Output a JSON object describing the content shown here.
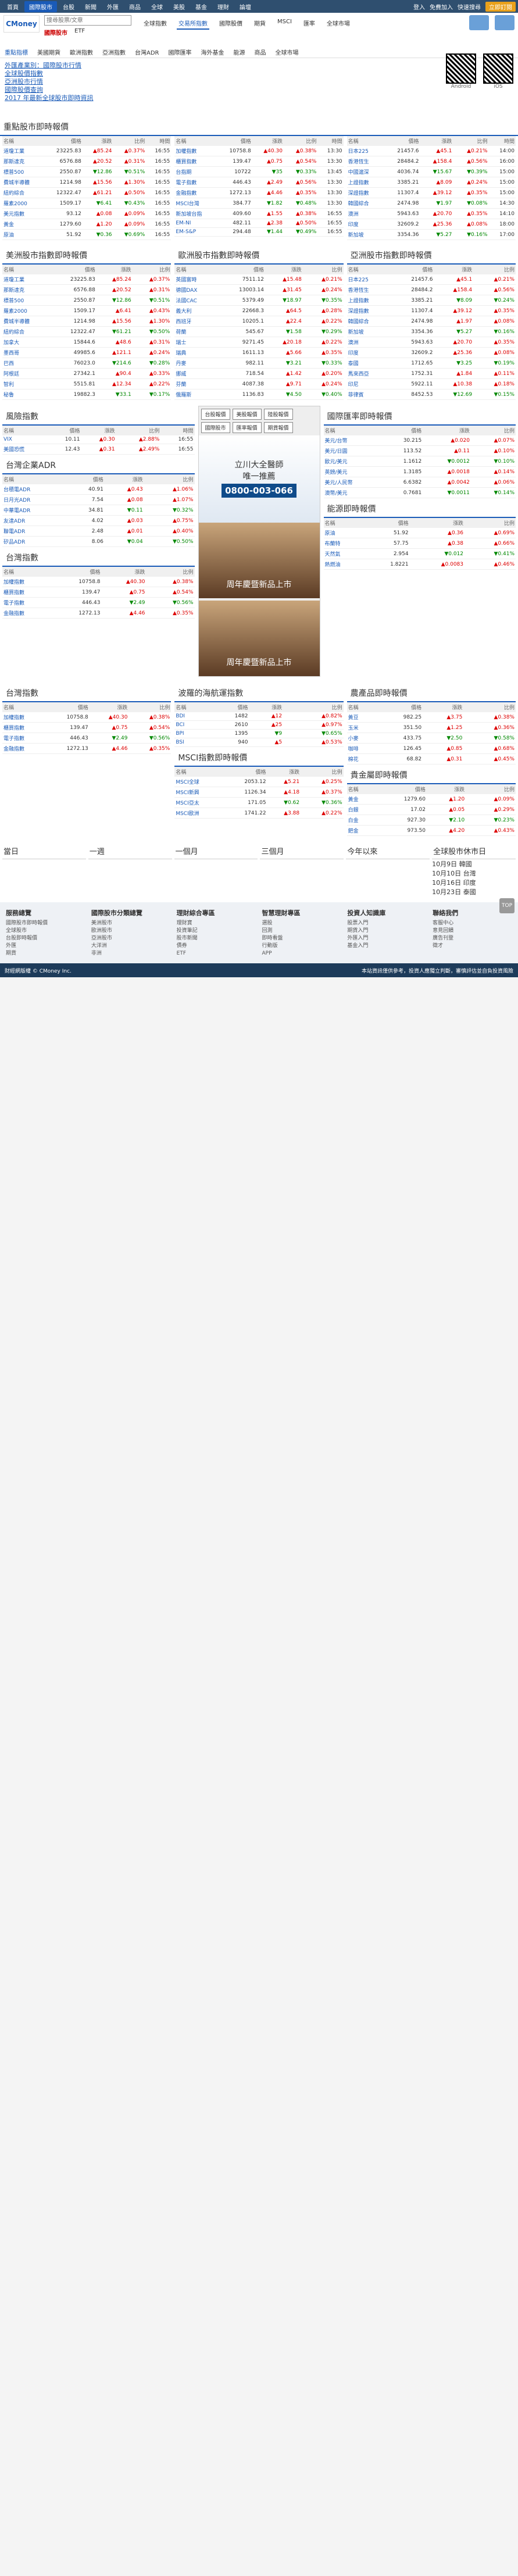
{
  "topbar": {
    "nav": [
      "首頁",
      "國際股市",
      "台股",
      "新聞",
      "外匯",
      "商品",
      "全球",
      "美股",
      "基金",
      "理財",
      "論壇"
    ],
    "active": 1,
    "right": [
      "登入",
      "免費加入",
      "快速搜尋"
    ],
    "btn": "立即訂閱"
  },
  "header": {
    "logo": "CMoney",
    "search_placeholder": "搜尋股票/文章",
    "search_tabs": [
      "國際股市",
      "ETF"
    ],
    "mid": [
      "全球指數",
      "交易所指數",
      "國際股價",
      "期貨",
      "MSCI",
      "匯率",
      "全球市場"
    ],
    "active": 1
  },
  "subnav": [
    "重點指標",
    "美國期貨",
    "歐洲指數",
    "亞洲指數",
    "台灣ADR",
    "國際匯率",
    "海外基金",
    "能源",
    "商品",
    "全球市場"
  ],
  "promo": {
    "links": [
      "外匯產業別：國際股市行情",
      "全球股價指數",
      "亞洲股市行情",
      "國際股價查詢",
      "2017 年最新全球股市即時資訊"
    ],
    "qr_caption": [
      "Android",
      "iOS"
    ]
  },
  "sections": {
    "major": {
      "title": "重點股市即時報價",
      "headers": [
        "名稱",
        "價格",
        "漲跌",
        "比例",
        "時間"
      ],
      "col1": [
        [
          "道瓊工業",
          "23225.83",
          "85.24",
          "0.37%",
          "16:55"
        ],
        [
          "那斯達克",
          "6576.88",
          "20.52",
          "0.31%",
          "16:55"
        ],
        [
          "標普500",
          "2550.87",
          "12.86",
          "0.51%",
          "16:55"
        ],
        [
          "費城半導體",
          "1214.98",
          "15.56",
          "1.30%",
          "16:55"
        ],
        [
          "紐約綜合",
          "12322.47",
          "61.21",
          "0.50%",
          "16:55"
        ],
        [
          "羅素2000",
          "1509.17",
          "6.41",
          "0.43%",
          "16:55"
        ],
        [
          "美元指數",
          "93.12",
          "0.08",
          "0.09%",
          "16:55"
        ],
        [
          "黃金",
          "1279.60",
          "1.20",
          "0.09%",
          "16:55"
        ],
        [
          "原油",
          "51.92",
          "0.36",
          "0.69%",
          "16:55"
        ]
      ],
      "col2": [
        [
          "加權指數",
          "10758.8",
          "40.30",
          "0.38%",
          "13:30"
        ],
        [
          "櫃買指數",
          "139.47",
          "0.75",
          "0.54%",
          "13:30"
        ],
        [
          "台指期",
          "10722",
          "35",
          "0.33%",
          "13:45"
        ],
        [
          "電子指數",
          "446.43",
          "2.49",
          "0.56%",
          "13:30"
        ],
        [
          "金融指數",
          "1272.13",
          "4.46",
          "0.35%",
          "13:30"
        ],
        [
          "MSCI台灣",
          "384.77",
          "1.82",
          "0.48%",
          "13:30"
        ],
        [
          "新加坡台指",
          "409.60",
          "1.55",
          "0.38%",
          "16:55"
        ],
        [
          "EM-NI",
          "482.11",
          "2.38",
          "0.50%",
          "16:55"
        ],
        [
          "EM-S&P",
          "294.48",
          "1.44",
          "0.49%",
          "16:55"
        ]
      ],
      "col3": [
        [
          "日本225",
          "21457.6",
          "45.1",
          "0.21%",
          "14:00"
        ],
        [
          "香港恆生",
          "28484.2",
          "158.4",
          "0.56%",
          "16:00"
        ],
        [
          "中國滬深",
          "4036.74",
          "15.67",
          "0.39%",
          "15:00"
        ],
        [
          "上證指數",
          "3385.21",
          "8.09",
          "0.24%",
          "15:00"
        ],
        [
          "深證指數",
          "11307.4",
          "39.12",
          "0.35%",
          "15:00"
        ],
        [
          "韓國綜合",
          "2474.98",
          "1.97",
          "0.08%",
          "14:30"
        ],
        [
          "澳洲",
          "5943.63",
          "20.70",
          "0.35%",
          "14:10"
        ],
        [
          "印度",
          "32609.2",
          "25.36",
          "0.08%",
          "18:00"
        ],
        [
          "新加坡",
          "3354.36",
          "5.27",
          "0.16%",
          "17:00"
        ]
      ]
    },
    "us": {
      "title": "美洲股市指數即時報價",
      "headers": [
        "名稱",
        "價格",
        "漲跌",
        "比例",
        "時間"
      ],
      "rows": [
        [
          "道瓊工業",
          "23225.83",
          "85.24",
          "0.37%"
        ],
        [
          "那斯達克",
          "6576.88",
          "20.52",
          "0.31%"
        ],
        [
          "標普500",
          "2550.87",
          "12.86",
          "0.51%"
        ],
        [
          "羅素2000",
          "1509.17",
          "6.41",
          "0.43%"
        ],
        [
          "費城半導體",
          "1214.98",
          "15.56",
          "1.30%"
        ],
        [
          "紐約綜合",
          "12322.47",
          "61.21",
          "0.50%"
        ],
        [
          "加拿大",
          "15844.6",
          "48.6",
          "0.31%"
        ],
        [
          "墨西哥",
          "49985.6",
          "121.1",
          "0.24%"
        ],
        [
          "巴西",
          "76023.0",
          "214.6",
          "0.28%"
        ],
        [
          "阿根廷",
          "27342.1",
          "90.4",
          "0.33%"
        ],
        [
          "智利",
          "5515.81",
          "12.34",
          "0.22%"
        ],
        [
          "秘魯",
          "19882.3",
          "33.1",
          "0.17%"
        ]
      ]
    },
    "eu": {
      "title": "歐洲股市指數即時報價",
      "headers": [
        "名稱",
        "價格",
        "漲跌",
        "比例",
        "時間"
      ],
      "rows": [
        [
          "英國富時",
          "7511.12",
          "15.48",
          "0.21%"
        ],
        [
          "德國DAX",
          "13003.14",
          "31.45",
          "0.24%"
        ],
        [
          "法國CAC",
          "5379.49",
          "18.97",
          "0.35%"
        ],
        [
          "義大利",
          "22668.3",
          "64.5",
          "0.28%"
        ],
        [
          "西班牙",
          "10205.1",
          "22.4",
          "0.22%"
        ],
        [
          "荷蘭",
          "545.67",
          "1.58",
          "0.29%"
        ],
        [
          "瑞士",
          "9271.45",
          "20.18",
          "0.22%"
        ],
        [
          "瑞典",
          "1611.13",
          "5.66",
          "0.35%"
        ],
        [
          "丹麥",
          "982.11",
          "3.21",
          "0.33%"
        ],
        [
          "挪威",
          "718.54",
          "1.42",
          "0.20%"
        ],
        [
          "芬蘭",
          "4087.38",
          "9.71",
          "0.24%"
        ],
        [
          "俄羅斯",
          "1136.83",
          "4.50",
          "0.40%"
        ]
      ]
    },
    "asia": {
      "title": "亞洲股市指數即時報價",
      "headers": [
        "名稱",
        "價格",
        "漲跌",
        "比例",
        "時間"
      ],
      "rows": [
        [
          "日本225",
          "21457.6",
          "45.1",
          "0.21%"
        ],
        [
          "香港恆生",
          "28484.2",
          "158.4",
          "0.56%"
        ],
        [
          "上證指數",
          "3385.21",
          "8.09",
          "0.24%"
        ],
        [
          "深證指數",
          "11307.4",
          "39.12",
          "0.35%"
        ],
        [
          "韓國綜合",
          "2474.98",
          "1.97",
          "0.08%"
        ],
        [
          "新加坡",
          "3354.36",
          "5.27",
          "0.16%"
        ],
        [
          "澳洲",
          "5943.63",
          "20.70",
          "0.35%"
        ],
        [
          "印度",
          "32609.2",
          "25.36",
          "0.08%"
        ],
        [
          "泰國",
          "1712.65",
          "3.25",
          "0.19%"
        ],
        [
          "馬來西亞",
          "1752.31",
          "1.84",
          "0.11%"
        ],
        [
          "印尼",
          "5922.11",
          "10.38",
          "0.18%"
        ],
        [
          "菲律賓",
          "8452.53",
          "12.69",
          "0.15%"
        ]
      ]
    },
    "risk": {
      "title": "風險指數",
      "headers": [
        "名稱",
        "價格",
        "漲跌",
        "比例",
        "時間"
      ],
      "rows": [
        [
          "VIX",
          "10.11",
          "0.30",
          "2.88%",
          "16:55"
        ],
        [
          "美國恐慌",
          "12.43",
          "0.31",
          "2.49%",
          "16:55"
        ]
      ]
    },
    "adr": {
      "title": "台灣企業ADR",
      "headers": [
        "名稱",
        "價格",
        "漲跌",
        "比例",
        "時間"
      ],
      "rows": [
        [
          "台積電ADR",
          "40.91",
          "0.43",
          "1.06%"
        ],
        [
          "日月光ADR",
          "7.54",
          "0.08",
          "1.07%"
        ],
        [
          "中華電ADR",
          "34.81",
          "0.11",
          "0.32%"
        ],
        [
          "友達ADR",
          "4.02",
          "0.03",
          "0.75%"
        ],
        [
          "聯電ADR",
          "2.48",
          "0.01",
          "0.40%"
        ],
        [
          "矽品ADR",
          "8.06",
          "0.04",
          "0.50%"
        ]
      ]
    },
    "fx": {
      "title": "國際匯率即時報價",
      "headers": [
        "名稱",
        "價格",
        "漲跌",
        "比例",
        "時間"
      ],
      "rows": [
        [
          "美元/台幣",
          "30.215",
          "0.020",
          "0.07%"
        ],
        [
          "美元/日圓",
          "113.52",
          "0.11",
          "0.10%"
        ],
        [
          "歐元/美元",
          "1.1612",
          "0.0012",
          "0.10%"
        ],
        [
          "英鎊/美元",
          "1.3185",
          "0.0018",
          "0.14%"
        ],
        [
          "美元/人民幣",
          "6.6382",
          "0.0042",
          "0.06%"
        ],
        [
          "澳幣/美元",
          "0.7681",
          "0.0011",
          "0.14%"
        ]
      ]
    },
    "tw": {
      "title": "台灣指數",
      "headers": [
        "名稱",
        "價格",
        "漲跌",
        "比例",
        "時間"
      ],
      "rows": [
        [
          "加權指數",
          "10758.8",
          "40.30",
          "0.38%"
        ],
        [
          "櫃買指數",
          "139.47",
          "0.75",
          "0.54%"
        ],
        [
          "電子指數",
          "446.43",
          "2.49",
          "0.56%"
        ],
        [
          "金融指數",
          "1272.13",
          "4.46",
          "0.35%"
        ]
      ]
    },
    "ship": {
      "title": "波羅的海航運指數",
      "headers": [
        "名稱",
        "價格",
        "漲跌",
        "比例",
        "時間"
      ],
      "rows": [
        [
          "BDI",
          "1482",
          "12",
          "0.82%"
        ],
        [
          "BCI",
          "2610",
          "25",
          "0.97%"
        ],
        [
          "BPI",
          "1395",
          "9",
          "0.65%"
        ],
        [
          "BSI",
          "940",
          "5",
          "0.53%"
        ]
      ]
    },
    "agri": {
      "title": "農產品即時報價",
      "headers": [
        "名稱",
        "價格",
        "漲跌",
        "比例",
        "時間"
      ],
      "rows": [
        [
          "黃豆",
          "982.25",
          "3.75",
          "0.38%"
        ],
        [
          "玉米",
          "351.50",
          "1.25",
          "0.36%"
        ],
        [
          "小麥",
          "433.75",
          "2.50",
          "0.58%"
        ],
        [
          "咖啡",
          "126.45",
          "0.85",
          "0.68%"
        ],
        [
          "棉花",
          "68.82",
          "0.31",
          "0.45%"
        ]
      ]
    },
    "msci": {
      "title": "MSCI指數即時報價",
      "headers": [
        "名稱",
        "價格",
        "漲跌",
        "比例",
        "時間"
      ],
      "rows": [
        [
          "MSCI全球",
          "2053.12",
          "5.21",
          "0.25%"
        ],
        [
          "MSCI新興",
          "1126.34",
          "4.18",
          "0.37%"
        ],
        [
          "MSCI亞太",
          "171.05",
          "0.62",
          "0.36%"
        ],
        [
          "MSCI歐洲",
          "1741.22",
          "3.88",
          "0.22%"
        ]
      ]
    },
    "metal": {
      "title": "貴金屬即時報價",
      "headers": [
        "名稱",
        "價格",
        "漲跌",
        "比例",
        "時間"
      ],
      "rows": [
        [
          "黃金",
          "1279.60",
          "1.20",
          "0.09%"
        ],
        [
          "白銀",
          "17.02",
          "0.05",
          "0.29%"
        ],
        [
          "白金",
          "927.30",
          "2.10",
          "0.23%"
        ],
        [
          "鈀金",
          "973.50",
          "4.20",
          "0.43%"
        ]
      ]
    },
    "energy": {
      "title": "能源即時報價",
      "headers": [
        "名稱",
        "價格",
        "漲跌",
        "比例",
        "時間"
      ],
      "rows": [
        [
          "原油",
          "51.92",
          "0.36",
          "0.69%"
        ],
        [
          "布蘭特",
          "57.75",
          "0.38",
          "0.66%"
        ],
        [
          "天然氣",
          "2.954",
          "0.012",
          "0.41%"
        ],
        [
          "熱燃油",
          "1.8221",
          "0.0083",
          "0.46%"
        ]
      ]
    }
  },
  "ad": {
    "btns": [
      "台股報價",
      "美股報價",
      "陸股報價",
      "國際股市",
      "匯率報價",
      "期貨報價"
    ],
    "title": "立川大全醫師",
    "sub": "唯一推薦",
    "phone": "0800-003-066",
    "bed1": "周年慶暨新品上市",
    "bed2": "周年慶暨新品上市"
  },
  "histories": {
    "title": "今天以來",
    "cols": [
      "當日",
      "一週",
      "一個月",
      "三個月",
      "今年以來",
      "全球股市休市日"
    ],
    "holiday_rows": [
      "10月9日 韓國",
      "10月10日 台灣",
      "10月16日 印度",
      "10月23日 泰國"
    ]
  },
  "footer": {
    "cols": [
      {
        "title": "服務總覽",
        "items": [
          "國際股市即時報價",
          "全球股市",
          "台股即時報價",
          "外匯",
          "期貨"
        ]
      },
      {
        "title": "國際股市分類總覽",
        "items": [
          "美洲股市",
          "歐洲股市",
          "亞洲股市",
          "大洋洲",
          "非洲"
        ]
      },
      {
        "title": "理財綜合專區",
        "items": [
          "理財寶",
          "投資筆記",
          "股市新聞",
          "債券",
          "ETF"
        ]
      },
      {
        "title": "智慧理財專區",
        "items": [
          "選股",
          "回測",
          "即時看盤",
          "行動版",
          "APP"
        ]
      },
      {
        "title": "投資人知識庫",
        "items": [
          "股票入門",
          "期貨入門",
          "外匯入門",
          "基金入門"
        ]
      },
      {
        "title": "聯絡我們",
        "items": [
          "客服中心",
          "意見回饋",
          "廣告刊登",
          "徵才"
        ]
      }
    ],
    "copy_left": "財經網版權 © CMoney Inc.",
    "copy_right": "本站資訊僅供參考，投資人應獨立判斷，審慎評估並自負投資風險"
  },
  "totop": "TOP"
}
